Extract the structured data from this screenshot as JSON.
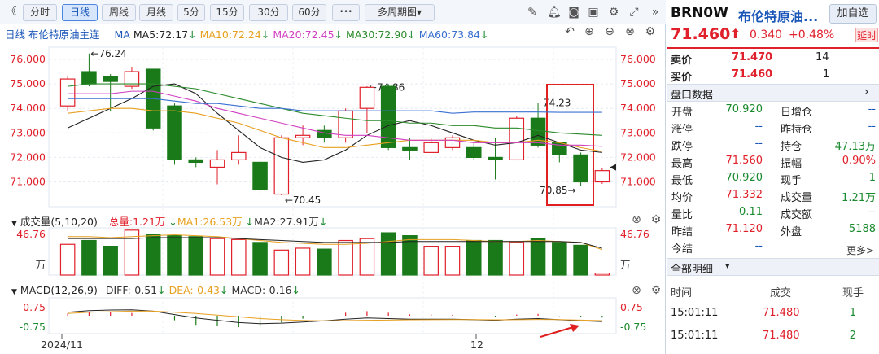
{
  "toolbar": {
    "collapse": "《",
    "periods": [
      "分时",
      "日线",
      "周线",
      "月线",
      "5分",
      "15分",
      "30分",
      "60分"
    ],
    "more": "•••",
    "multi": "多周期图",
    "multi_arrow": "▾"
  },
  "legend": {
    "title": "日线",
    "name": "布伦特原油主连",
    "ma_label": "MA",
    "ma5": "MA5:72.17",
    "ma10": "MA10:72.24",
    "ma20": "MA20:72.45",
    "ma30": "MA30:72.90",
    "ma60": "MA60:73.84",
    "arrow": "↓"
  },
  "axis": {
    "price_left": [
      "76.000",
      "75.000",
      "74.000",
      "73.000",
      "72.000",
      "71.000"
    ],
    "price_right": [
      "76.000",
      "75.000",
      "74.000",
      "73.000",
      "72.000",
      "71.000"
    ],
    "ann_high": "76.24",
    "ann_mid": "74.86",
    "ann_right": "74.23",
    "ann_low": "70.45",
    "ann_low2": "70.85",
    "vol_top": "46.76",
    "vol_unit": "万",
    "macd_top": "0.75",
    "macd_bot": "-0.75",
    "date1": "2024/11",
    "date2": "12"
  },
  "volume": {
    "label": "成交量(5,10,20)",
    "total": "总量:1.21万",
    "ma1": "MA1:26.53万",
    "ma2": "MA2:27.91万"
  },
  "macd": {
    "label": "MACD(12,26,9)",
    "diff": "DIFF:-0.51",
    "dea": "DEA:-0.43",
    "macd": "MACD:-0.16"
  },
  "quote": {
    "code": "BRN0W",
    "name": "布伦特原油...",
    "add": "加自选",
    "price": "71.460",
    "arrow": "⬆",
    "change": "0.340",
    "pct": "+0.48%",
    "delay": "延时"
  },
  "book": {
    "sell_label": "卖价",
    "sell_price": "71.470",
    "sell_qty": "14",
    "buy_label": "买价",
    "buy_price": "71.460",
    "buy_qty": "1"
  },
  "panel": {
    "title": "盘口数据",
    "more": "更多>"
  },
  "stats": [
    [
      "开盘",
      "70.920",
      "日增仓",
      "--"
    ],
    [
      "涨停",
      "--",
      "昨持仓",
      "--"
    ],
    [
      "跌停",
      "--",
      "持仓",
      "47.13万"
    ],
    [
      "最高",
      "71.560",
      "振幅",
      "0.90%"
    ],
    [
      "最低",
      "70.920",
      "现手",
      "1"
    ],
    [
      "均价",
      "71.332",
      "成交量",
      "1.21万"
    ],
    [
      "量比",
      "0.11",
      "成交额",
      "--"
    ],
    [
      "昨结",
      "71.120",
      "外盘",
      "5188"
    ],
    [
      "今结",
      "--",
      "",
      ""
    ]
  ],
  "ticks": {
    "title": "全部明细",
    "arrow": "▾",
    "col_time": "时间",
    "col_price": "成交",
    "col_qty": "现手",
    "rows": [
      [
        "15:01:11",
        "71.480",
        "1"
      ],
      [
        "15:01:11",
        "71.480",
        "2"
      ]
    ]
  },
  "colors": {
    "up": "#e0202a",
    "down": "#1a7a1a",
    "ma5": "#222222",
    "ma10": "#e8a020",
    "ma20": "#d040c0",
    "ma30": "#2a8a2a",
    "ma60": "#3a70d0",
    "highlight": "#e02020"
  }
}
